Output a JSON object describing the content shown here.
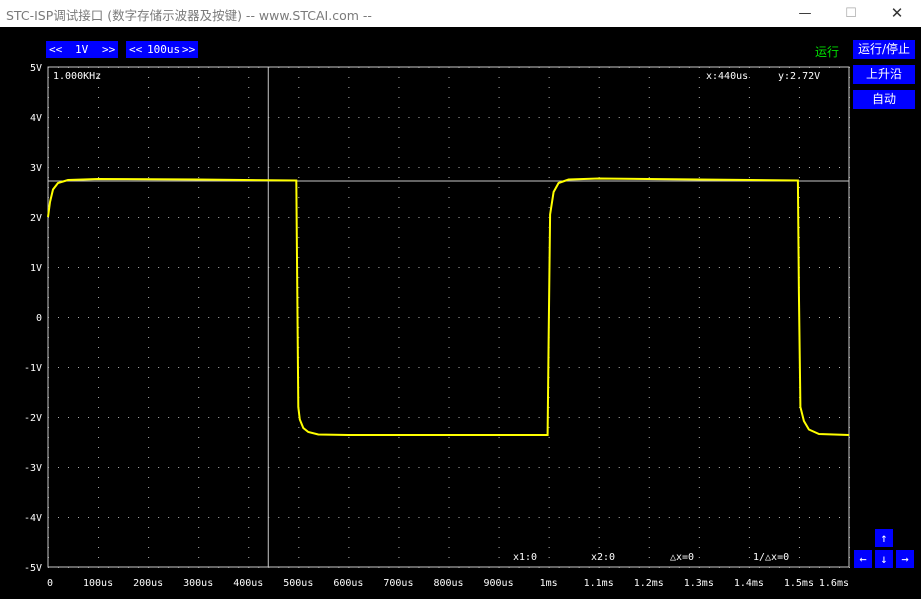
{
  "window": {
    "title": "STC-ISP调试接口 (数字存储示波器及按键) -- www.STCAI.com --",
    "min_label": "—",
    "max_label": "☐",
    "close_label": "✕"
  },
  "toolbar": {
    "volt_prev": "<<",
    "volt_value": "1V",
    "volt_next": ">>",
    "time_prev": "<<",
    "time_value": "100us",
    "time_next": ">>",
    "run_status": "运行"
  },
  "side_buttons": {
    "run_stop": "运行/停止",
    "trigger_edge": "上升沿",
    "trigger_mode": "自动"
  },
  "nav_arrows": {
    "up": "↑",
    "left": "←",
    "down": "↓",
    "right": "→"
  },
  "readouts": {
    "frequency": "1.000KHz",
    "cursor_x": "x:440us",
    "cursor_y": "y:2.72V",
    "x1": "x1:0",
    "x2": "x2:0",
    "delta_x": "△x=0",
    "inv_delta_x": "1/△x=0"
  },
  "colors": {
    "trace": "#ffff00",
    "grid_dots": "#b0b0b0",
    "frame": "#c8c8c8",
    "button": "#0000ff",
    "status": "#00e000"
  },
  "chart_data": {
    "type": "line",
    "title": "",
    "xlabel": "",
    "ylabel": "",
    "xlim": [
      0,
      1600
    ],
    "ylim": [
      -5,
      5
    ],
    "y_ticks": [
      "5V",
      "4V",
      "3V",
      "2V",
      "1V",
      "0",
      "-1V",
      "-2V",
      "-3V",
      "-4V",
      "-5V"
    ],
    "x_ticks": [
      "0",
      "100us",
      "200us",
      "300us",
      "400us",
      "500us",
      "600us",
      "700us",
      "800us",
      "900us",
      "1ms",
      "1.1ms",
      "1.2ms",
      "1.3ms",
      "1.4ms",
      "1.5ms",
      "1.6ms"
    ],
    "grid": true,
    "cursor": {
      "x": 440,
      "y": 2.72
    },
    "series": [
      {
        "x": [
          0,
          4,
          10,
          20,
          40,
          100,
          300,
          496,
          498,
          500,
          503,
          510,
          520,
          540,
          600,
          998,
          1000,
          1003,
          1010,
          1020,
          1040,
          1100,
          1498,
          1500,
          1503,
          1510,
          1520,
          1540,
          1600
        ],
        "values": [
          2.0,
          2.3,
          2.55,
          2.68,
          2.74,
          2.76,
          2.75,
          2.73,
          0.5,
          -1.8,
          -2.05,
          -2.22,
          -2.3,
          -2.35,
          -2.36,
          -2.36,
          -0.5,
          2.05,
          2.5,
          2.68,
          2.75,
          2.77,
          2.73,
          0.5,
          -1.8,
          -2.08,
          -2.25,
          -2.34,
          -2.36
        ]
      }
    ]
  }
}
